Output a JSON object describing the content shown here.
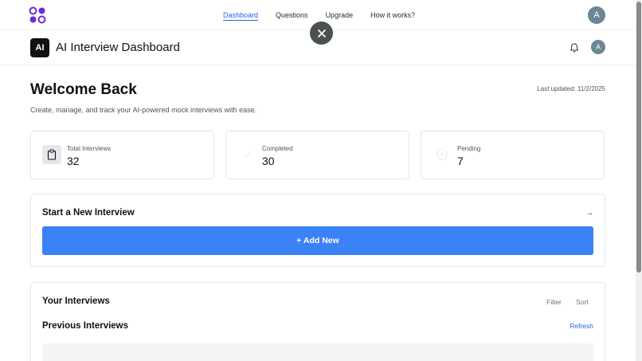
{
  "topnav": {
    "links": [
      "Dashboard",
      "Questions",
      "Upgrade",
      "How it works?"
    ],
    "active": "Dashboard",
    "avatar_letter": "A"
  },
  "header": {
    "brand_badge": "AI",
    "title": "AI Interview Dashboard",
    "avatar_letter": "A"
  },
  "main": {
    "welcome": "Welcome Back",
    "last_updated": "Last updated: 11/2/2025",
    "subtitle": "Create, manage, and track your AI-powered mock interviews with ease."
  },
  "stats": [
    {
      "label": "Total Interviews",
      "value": "32",
      "icon": "clipboard-icon"
    },
    {
      "label": "Completed",
      "value": "30",
      "icon": "check-icon"
    },
    {
      "label": "Pending",
      "value": "7",
      "icon": "clock-icon"
    }
  ],
  "new_interview": {
    "title": "Start a New Interview",
    "arrow": "→",
    "button_label": "+ Add New"
  },
  "interviews": {
    "title": "Your Interviews",
    "filter_label": "Filter",
    "sort_label": "Sort",
    "previous_title": "Previous Interviews",
    "refresh_label": "Refresh"
  },
  "colors": {
    "accent": "#3b82f6",
    "link_active": "#2563eb",
    "avatar": "#6b8793"
  }
}
